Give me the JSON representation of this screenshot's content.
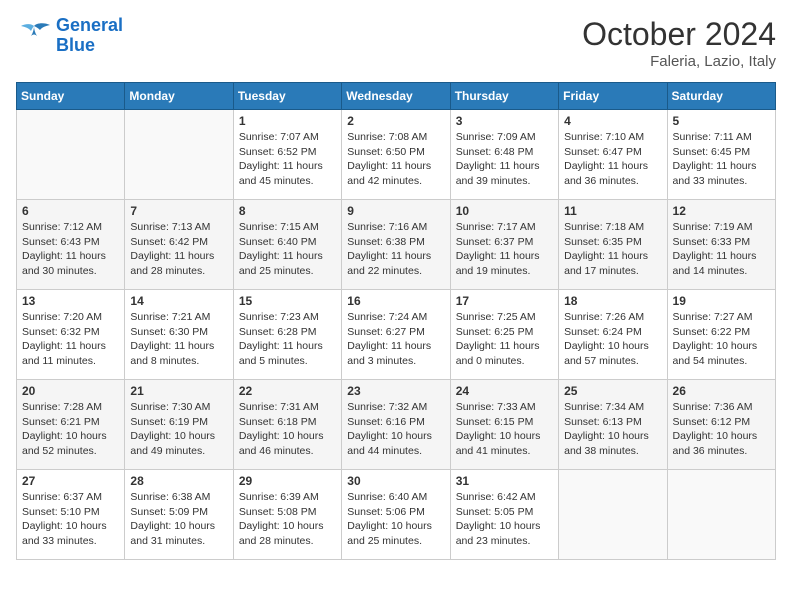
{
  "header": {
    "logo_line1": "General",
    "logo_line2": "Blue",
    "month": "October 2024",
    "location": "Faleria, Lazio, Italy"
  },
  "days_of_week": [
    "Sunday",
    "Monday",
    "Tuesday",
    "Wednesday",
    "Thursday",
    "Friday",
    "Saturday"
  ],
  "weeks": [
    [
      {
        "day": "",
        "info": ""
      },
      {
        "day": "",
        "info": ""
      },
      {
        "day": "1",
        "info": "Sunrise: 7:07 AM\nSunset: 6:52 PM\nDaylight: 11 hours and 45 minutes."
      },
      {
        "day": "2",
        "info": "Sunrise: 7:08 AM\nSunset: 6:50 PM\nDaylight: 11 hours and 42 minutes."
      },
      {
        "day": "3",
        "info": "Sunrise: 7:09 AM\nSunset: 6:48 PM\nDaylight: 11 hours and 39 minutes."
      },
      {
        "day": "4",
        "info": "Sunrise: 7:10 AM\nSunset: 6:47 PM\nDaylight: 11 hours and 36 minutes."
      },
      {
        "day": "5",
        "info": "Sunrise: 7:11 AM\nSunset: 6:45 PM\nDaylight: 11 hours and 33 minutes."
      }
    ],
    [
      {
        "day": "6",
        "info": "Sunrise: 7:12 AM\nSunset: 6:43 PM\nDaylight: 11 hours and 30 minutes."
      },
      {
        "day": "7",
        "info": "Sunrise: 7:13 AM\nSunset: 6:42 PM\nDaylight: 11 hours and 28 minutes."
      },
      {
        "day": "8",
        "info": "Sunrise: 7:15 AM\nSunset: 6:40 PM\nDaylight: 11 hours and 25 minutes."
      },
      {
        "day": "9",
        "info": "Sunrise: 7:16 AM\nSunset: 6:38 PM\nDaylight: 11 hours and 22 minutes."
      },
      {
        "day": "10",
        "info": "Sunrise: 7:17 AM\nSunset: 6:37 PM\nDaylight: 11 hours and 19 minutes."
      },
      {
        "day": "11",
        "info": "Sunrise: 7:18 AM\nSunset: 6:35 PM\nDaylight: 11 hours and 17 minutes."
      },
      {
        "day": "12",
        "info": "Sunrise: 7:19 AM\nSunset: 6:33 PM\nDaylight: 11 hours and 14 minutes."
      }
    ],
    [
      {
        "day": "13",
        "info": "Sunrise: 7:20 AM\nSunset: 6:32 PM\nDaylight: 11 hours and 11 minutes."
      },
      {
        "day": "14",
        "info": "Sunrise: 7:21 AM\nSunset: 6:30 PM\nDaylight: 11 hours and 8 minutes."
      },
      {
        "day": "15",
        "info": "Sunrise: 7:23 AM\nSunset: 6:28 PM\nDaylight: 11 hours and 5 minutes."
      },
      {
        "day": "16",
        "info": "Sunrise: 7:24 AM\nSunset: 6:27 PM\nDaylight: 11 hours and 3 minutes."
      },
      {
        "day": "17",
        "info": "Sunrise: 7:25 AM\nSunset: 6:25 PM\nDaylight: 11 hours and 0 minutes."
      },
      {
        "day": "18",
        "info": "Sunrise: 7:26 AM\nSunset: 6:24 PM\nDaylight: 10 hours and 57 minutes."
      },
      {
        "day": "19",
        "info": "Sunrise: 7:27 AM\nSunset: 6:22 PM\nDaylight: 10 hours and 54 minutes."
      }
    ],
    [
      {
        "day": "20",
        "info": "Sunrise: 7:28 AM\nSunset: 6:21 PM\nDaylight: 10 hours and 52 minutes."
      },
      {
        "day": "21",
        "info": "Sunrise: 7:30 AM\nSunset: 6:19 PM\nDaylight: 10 hours and 49 minutes."
      },
      {
        "day": "22",
        "info": "Sunrise: 7:31 AM\nSunset: 6:18 PM\nDaylight: 10 hours and 46 minutes."
      },
      {
        "day": "23",
        "info": "Sunrise: 7:32 AM\nSunset: 6:16 PM\nDaylight: 10 hours and 44 minutes."
      },
      {
        "day": "24",
        "info": "Sunrise: 7:33 AM\nSunset: 6:15 PM\nDaylight: 10 hours and 41 minutes."
      },
      {
        "day": "25",
        "info": "Sunrise: 7:34 AM\nSunset: 6:13 PM\nDaylight: 10 hours and 38 minutes."
      },
      {
        "day": "26",
        "info": "Sunrise: 7:36 AM\nSunset: 6:12 PM\nDaylight: 10 hours and 36 minutes."
      }
    ],
    [
      {
        "day": "27",
        "info": "Sunrise: 6:37 AM\nSunset: 5:10 PM\nDaylight: 10 hours and 33 minutes."
      },
      {
        "day": "28",
        "info": "Sunrise: 6:38 AM\nSunset: 5:09 PM\nDaylight: 10 hours and 31 minutes."
      },
      {
        "day": "29",
        "info": "Sunrise: 6:39 AM\nSunset: 5:08 PM\nDaylight: 10 hours and 28 minutes."
      },
      {
        "day": "30",
        "info": "Sunrise: 6:40 AM\nSunset: 5:06 PM\nDaylight: 10 hours and 25 minutes."
      },
      {
        "day": "31",
        "info": "Sunrise: 6:42 AM\nSunset: 5:05 PM\nDaylight: 10 hours and 23 minutes."
      },
      {
        "day": "",
        "info": ""
      },
      {
        "day": "",
        "info": ""
      }
    ]
  ]
}
